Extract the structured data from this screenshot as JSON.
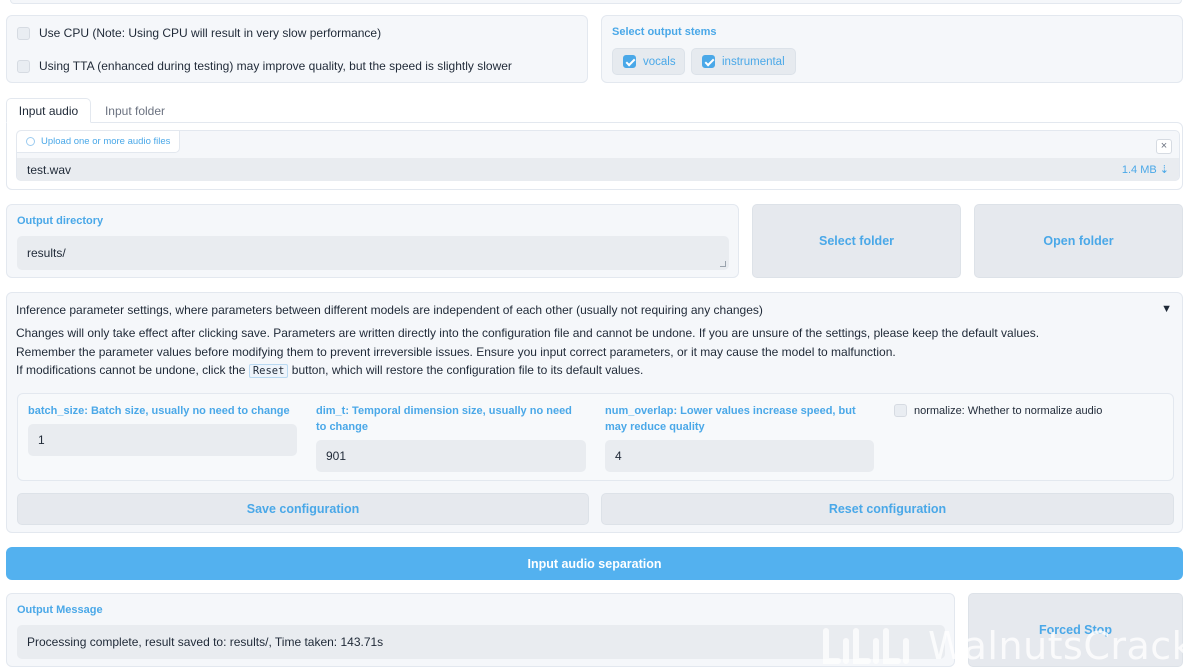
{
  "options": {
    "use_cpu": "Use CPU (Note: Using CPU will result in very slow performance)",
    "use_tta": "Using TTA (enhanced during testing) may improve quality, but the speed is slightly slower"
  },
  "stems": {
    "label": "Select output stems",
    "items": [
      "vocals",
      "instrumental"
    ]
  },
  "input_tabs": [
    "Input audio",
    "Input folder"
  ],
  "upload": {
    "label": "Upload one or more audio files",
    "close_glyph": "×",
    "file_name": "test.wav",
    "file_size": "1.4 MB",
    "download_glyph": "⇣"
  },
  "output_dir": {
    "label": "Output directory",
    "value": "results/"
  },
  "folder_buttons": {
    "select": "Select folder",
    "open": "Open folder"
  },
  "inference": {
    "title": "Inference parameter settings, where parameters between different models are independent of each other (usually not requiring any changes)",
    "toggle_glyph": "▼",
    "line1": "Changes will only take effect after clicking save. Parameters are written directly into the configuration file and cannot be undone. If you are unsure of the settings, please keep the default values.",
    "line2": "Remember the parameter values before modifying them to prevent irreversible issues. Ensure you input correct parameters, or it may cause the model to malfunction.",
    "line3_pre": "If modifications cannot be undone, click the",
    "line3_code": "Reset",
    "line3_post": "button, which will restore the configuration file to its default values.",
    "params": {
      "batch_size_label": "batch_size: Batch size, usually no need to change",
      "batch_size_value": "1",
      "dim_t_label": "dim_t: Temporal dimension size, usually no need to change",
      "dim_t_value": "901",
      "num_overlap_label": "num_overlap: Lower values increase speed, but may reduce quality",
      "num_overlap_value": "4",
      "normalize_label": "normalize: Whether to normalize audio"
    },
    "save_button": "Save configuration",
    "reset_button": "Reset configuration"
  },
  "run_button": "Input audio separation",
  "output_message": {
    "label": "Output Message",
    "value": "Processing complete, result saved to: results/, Time taken: 143.71s"
  },
  "forced_stop": "Forced Stop",
  "watermark": "WalnutsCracker"
}
